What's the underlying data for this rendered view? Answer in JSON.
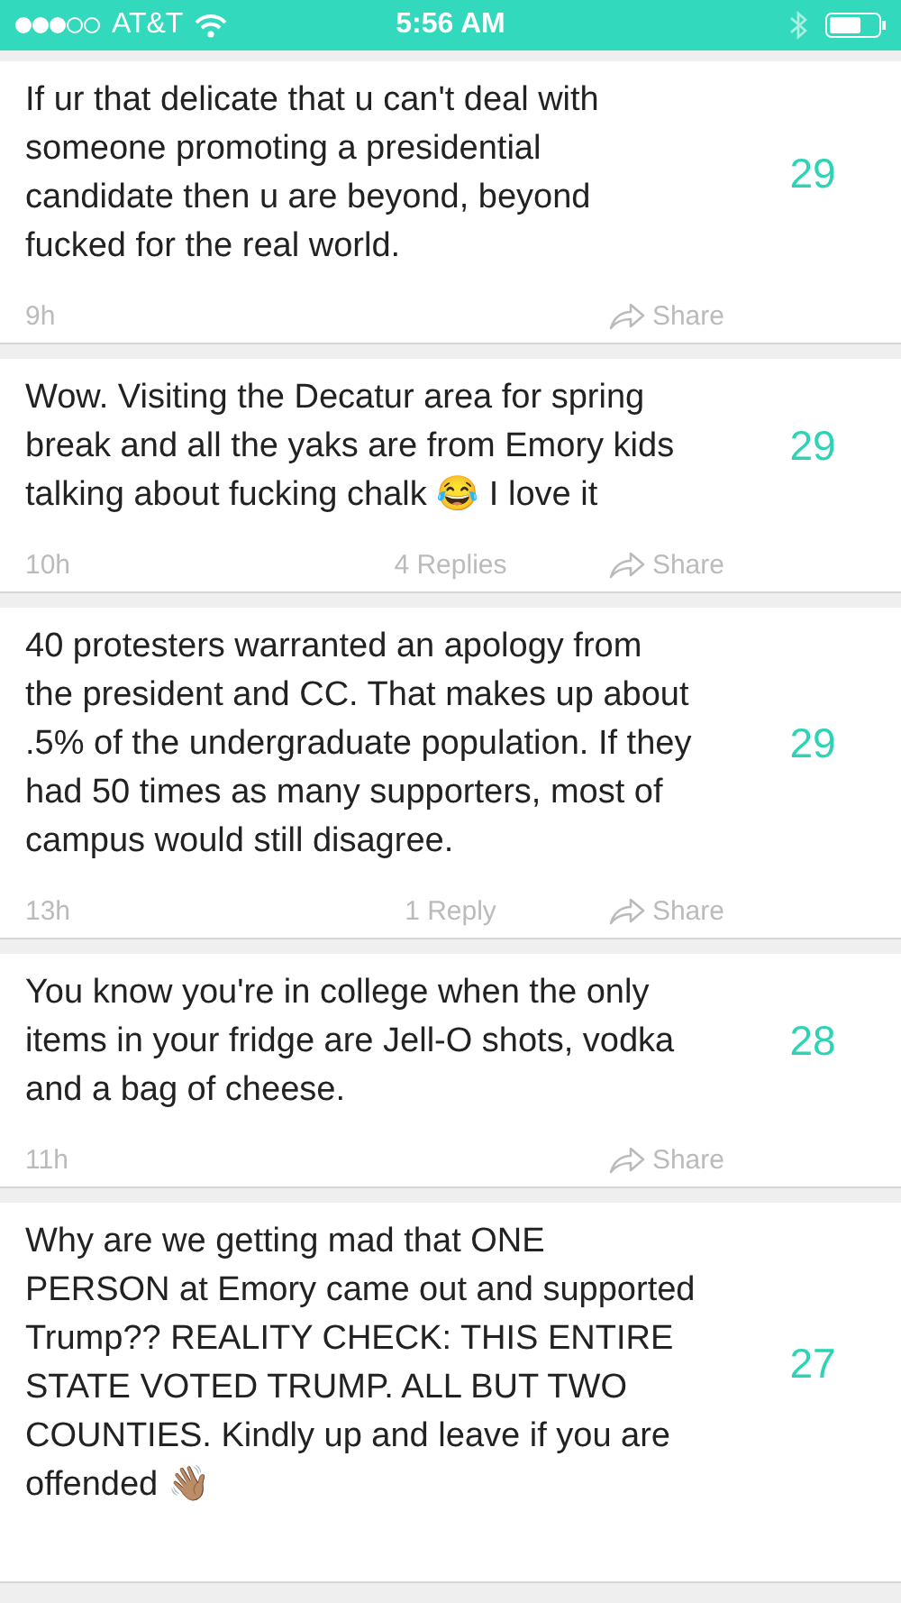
{
  "status_bar": {
    "carrier": "AT&T",
    "time": "5:56 AM"
  },
  "posts": [
    {
      "text": "If ur that delicate that u can't deal with someone promoting a presidential candidate then u are beyond, beyond fucked for the real world.",
      "score": "29",
      "time": "9h",
      "share": "Share"
    },
    {
      "text": "Wow. Visiting the Decatur area for spring break and all the yaks are from Emory kids talking about fucking chalk 😂 I love it",
      "score": "29",
      "time": "10h",
      "replies": "4 Replies",
      "share": "Share"
    },
    {
      "text": "40 protesters warranted an apology from the president and CC. That makes up about .5% of the undergraduate population. If they had 50 times as many supporters, most of campus would still disagree.",
      "score": "29",
      "time": "13h",
      "replies": "1 Reply",
      "share": "Share"
    },
    {
      "text": "You know you're in college when the only items in your fridge are Jell-O shots, vodka and a bag of cheese.",
      "score": "28",
      "time": "11h",
      "share": "Share"
    },
    {
      "text": "Why are we getting mad that ONE PERSON at Emory came out and supported Trump?? REALITY CHECK: THIS ENTIRE STATE VOTED TRUMP. ALL BUT TWO COUNTIES. Kindly up and leave if you are offended 👋🏽",
      "score": "27"
    }
  ]
}
